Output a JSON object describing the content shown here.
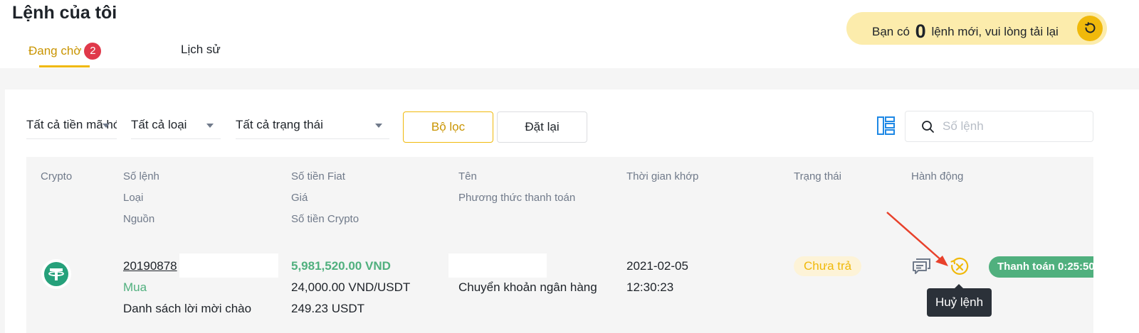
{
  "page": {
    "title": "Lệnh của tôi"
  },
  "tabs": {
    "pending_label": "Đang chờ",
    "pending_count": "2",
    "history_label": "Lịch sử"
  },
  "notice": {
    "prefix": "Bạn có",
    "count": "0",
    "suffix": "lệnh mới, vui lòng tải lại",
    "reload_icon": "reload-icon"
  },
  "filters": {
    "coin": "Tất cả tiền mã hóa",
    "type": "Tất cả loại",
    "status": "Tất cả trạng thái",
    "filter_button": "Bộ lọc",
    "reset_button": "Đặt lại",
    "search_placeholder": "Số lệnh"
  },
  "columns": {
    "crypto": "Crypto",
    "order_no": "Số lệnh",
    "type": "Loại",
    "source": "Nguồn",
    "fiat_amount": "Số tiền Fiat",
    "price": "Giá",
    "crypto_amount": "Số tiền Crypto",
    "name": "Tên",
    "payment_method": "Phương thức thanh toán",
    "match_time": "Thời gian khớp",
    "status": "Trạng thái",
    "action": "Hành động"
  },
  "order": {
    "coin_icon": "tether-icon",
    "order_no": "20190878",
    "type": "Mua",
    "source": "Danh sách lời mời chào",
    "fiat_amount": "5,981,520.00 VND",
    "price": "24,000.00 VND/USDT",
    "crypto_amount": "249.23 USDT",
    "payment_method": "Chuyển khoản ngân hàng",
    "date": "2021-02-05",
    "time": "12:30:23",
    "status": "Chưa trả",
    "payment_badge": "Thanh toán 0:25:50"
  },
  "tooltip": {
    "cancel": "Huỷ lệnh"
  },
  "colors": {
    "accent": "#f0b90b",
    "buy_green": "#50b07e",
    "badge_red": "#e0394a",
    "annotation_red": "#e8412b"
  }
}
